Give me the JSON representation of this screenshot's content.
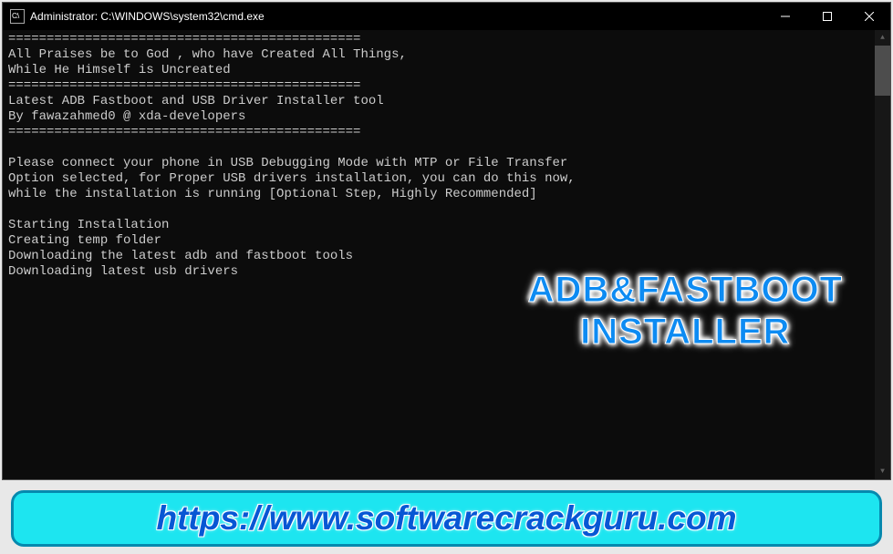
{
  "titlebar": {
    "icon_text": "C:\\",
    "title": "Administrator: C:\\WINDOWS\\system32\\cmd.exe"
  },
  "console": {
    "lines": [
      "==============================================",
      "All Praises be to God , who have Created All Things,",
      "While He Himself is Uncreated",
      "==============================================",
      "Latest ADB Fastboot and USB Driver Installer tool",
      "By fawazahmed0 @ xda-developers",
      "==============================================",
      "",
      "Please connect your phone in USB Debugging Mode with MTP or File Transfer",
      "Option selected, for Proper USB drivers installation, you can do this now,",
      "while the installation is running [Optional Step, Highly Recommended]",
      "",
      "Starting Installation",
      "Creating temp folder",
      "Downloading the latest adb and fastboot tools",
      "Downloading latest usb drivers"
    ]
  },
  "overlay": {
    "line1": "ADB&FASTBOOT",
    "line2": "INSTALLER"
  },
  "banner": {
    "url": "https://www.softwarecrackguru.com"
  }
}
